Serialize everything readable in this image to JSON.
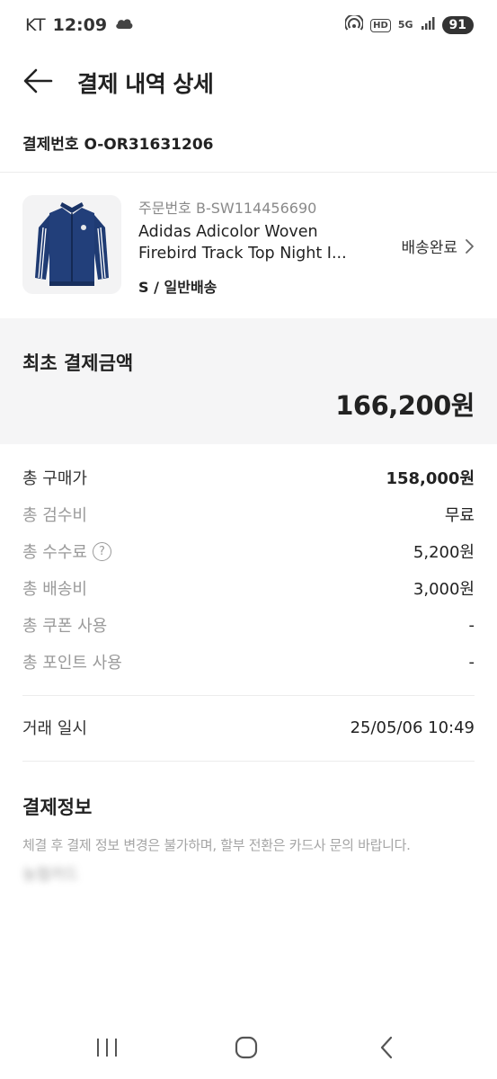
{
  "status_bar": {
    "carrier": "KT",
    "time": "12:09",
    "hd_label": "HD",
    "network_label": "5G",
    "battery": "91"
  },
  "header": {
    "title": "결제 내역 상세"
  },
  "payment_number": "결제번호 O-OR31631206",
  "product": {
    "order_number": "주문번호 B-SW114456690",
    "name_line1": "Adidas Adicolor Woven",
    "name_line2": "Firebird Track Top Night I...",
    "option": "S / 일반배송",
    "status": "배송완료",
    "icons": {
      "thumbnail": "jacket-image",
      "chevron": "chevron-right-icon"
    }
  },
  "first_payment": {
    "label": "최초 결제금액",
    "amount": "166,200원"
  },
  "breakdown": [
    {
      "label": "총 구매가",
      "value": "158,000원"
    },
    {
      "label": "총 검수비",
      "value": "무료"
    },
    {
      "label": "총 수수료",
      "value": "5,200원"
    },
    {
      "label": "총 배송비",
      "value": "3,000원"
    },
    {
      "label": "총 쿠폰 사용",
      "value": "-"
    },
    {
      "label": "총 포인트 사용",
      "value": "-"
    }
  ],
  "trade": {
    "label": "거래 일시",
    "value": "25/05/06 10:49"
  },
  "payment_info": {
    "title": "결제정보",
    "notice": "체결 후 결제 정보 변경은 불가하며, 할부 전환은 카드사 문의 바랍니다.",
    "blurred_text": "농협카드"
  },
  "colors": {
    "background": "#ffffff",
    "section_bg": "#f5f5f6",
    "text_primary": "#222222",
    "text_muted": "#9a9a9a",
    "divider": "#ececec"
  }
}
